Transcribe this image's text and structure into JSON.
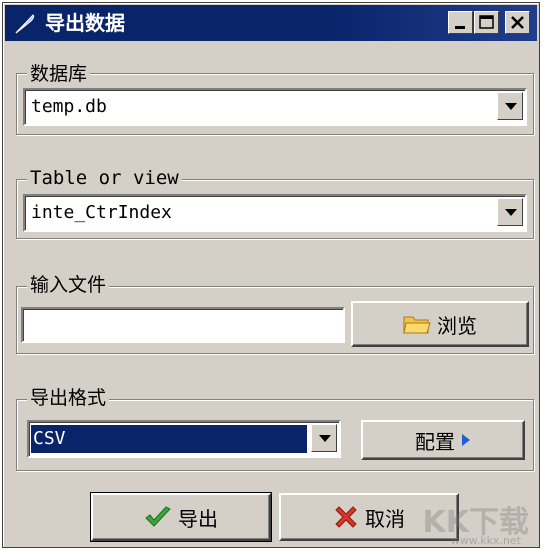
{
  "window": {
    "title": "导出数据",
    "controls": [
      "minimize-icon",
      "maximize-icon",
      "close-icon"
    ]
  },
  "database_group": {
    "label": "数据库",
    "value": "temp.db"
  },
  "table_group": {
    "label": "Table or view",
    "value": "inte_CtrIndex"
  },
  "input_file_group": {
    "label": "输入文件",
    "value": "",
    "browse_label": "浏览"
  },
  "format_group": {
    "label": "导出格式",
    "value": "CSV",
    "config_label": "配置"
  },
  "actions": {
    "export_label": "导出",
    "cancel_label": "取消"
  },
  "watermark": {
    "text": "KK下载",
    "url": "www.kkx.net"
  },
  "colors": {
    "titlebar": "#0a246a",
    "face": "#d4d0c8",
    "selection": "#0a246a",
    "check": "#3aa63a",
    "cross": "#d9342b",
    "arrow": "#1f5fd6",
    "folder": "#f2c14e"
  }
}
